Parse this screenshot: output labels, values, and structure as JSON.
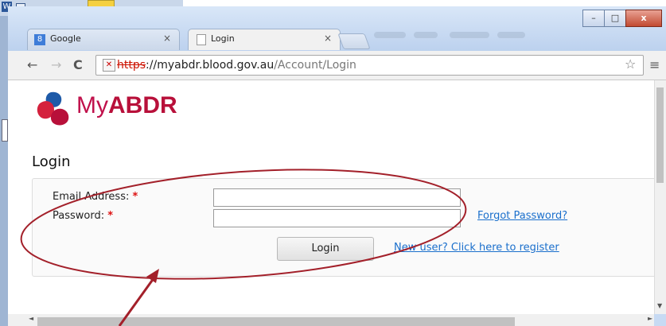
{
  "word": {
    "app_icon": "W"
  },
  "window": {
    "controls": {
      "minimize": "–",
      "maximize": "□",
      "close": "x"
    }
  },
  "tabs": [
    {
      "label": "Google",
      "icon": "8",
      "close": "×"
    },
    {
      "label": "Login",
      "icon": "",
      "close": "×"
    }
  ],
  "toolbar": {
    "back": "←",
    "forward": "→",
    "reload": "C",
    "security_icon": "✕",
    "url_scheme": "https",
    "url_host": "://myabdr.blood.gov.au",
    "url_path": "/Account/Login",
    "star": "☆",
    "menu": "≡"
  },
  "logo": {
    "my": "My",
    "abdr": "ABDR"
  },
  "login": {
    "title": "Login",
    "email_label": "Email Address:",
    "password_label": "Password:",
    "required_mark": "*",
    "email_value": "",
    "password_value": "",
    "forgot_link": "Forgot Password?",
    "login_button": "Login",
    "register_link": "New user? Click here to register"
  },
  "scroll": {
    "up": "▲",
    "down": "▼",
    "left": "◄",
    "right": "►"
  },
  "annotation": {
    "color": "#a3202a"
  }
}
